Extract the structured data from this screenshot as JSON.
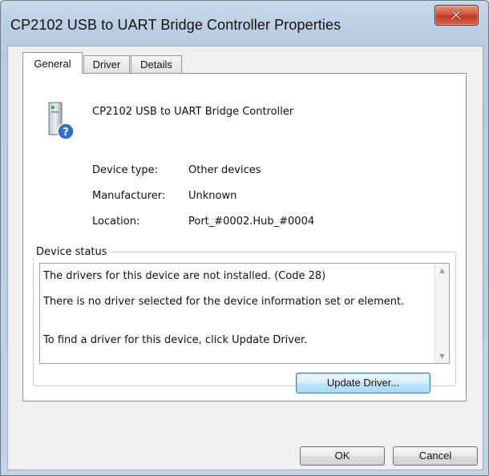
{
  "window": {
    "title": "CP2102 USB to UART Bridge Controller Properties",
    "close_label": "X"
  },
  "tabs": [
    {
      "label": "General",
      "active": true
    },
    {
      "label": "Driver",
      "active": false
    },
    {
      "label": "Details",
      "active": false
    }
  ],
  "device": {
    "name": "CP2102 USB to UART Bridge Controller",
    "icon": "unknown-device-icon",
    "properties": [
      {
        "label": "Device type:",
        "value": "Other devices"
      },
      {
        "label": "Manufacturer:",
        "value": "Unknown"
      },
      {
        "label": "Location:",
        "value": "Port_#0002.Hub_#0004"
      }
    ]
  },
  "status": {
    "legend": "Device status",
    "lines": [
      "The drivers for this device are not installed. (Code 28)",
      "There is no driver selected for the device information set or element.",
      "To find a driver for this device, click Update Driver."
    ]
  },
  "buttons": {
    "update_driver": "Update Driver...",
    "ok": "OK",
    "cancel": "Cancel"
  },
  "colors": {
    "close_button": "#c9462d",
    "focused_button": "#bee6fd"
  }
}
